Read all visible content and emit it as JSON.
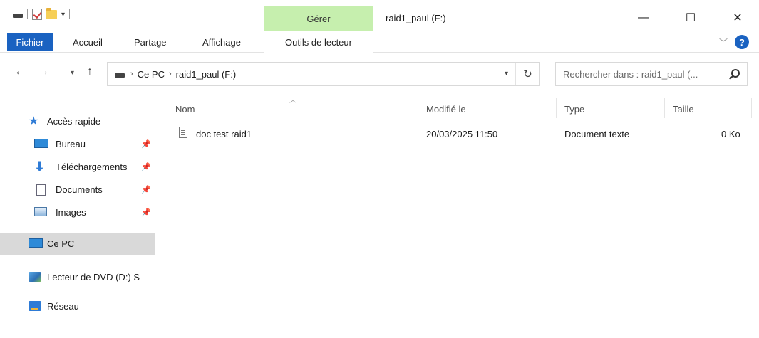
{
  "window": {
    "title": "raid1_paul (F:)",
    "manage_tab": "Gérer",
    "controls": {
      "minimize": "—",
      "maximize": "☐",
      "close": "✕"
    }
  },
  "ribbon": {
    "tabs": [
      "Fichier",
      "Accueil",
      "Partage",
      "Affichage",
      "Outils de lecteur"
    ],
    "collapse_icon": "chevron-down-icon",
    "help_label": "?"
  },
  "address": {
    "crumbs": [
      "Ce PC",
      "raid1_paul (F:)"
    ],
    "separator": "›"
  },
  "search": {
    "placeholder": "Rechercher dans : raid1_paul (..."
  },
  "nav_pane": {
    "items": [
      {
        "label": "Accès rapide",
        "icon": "star-icon",
        "pinned": false
      },
      {
        "label": "Bureau",
        "icon": "desktop-icon",
        "pinned": true
      },
      {
        "label": "Téléchargements",
        "icon": "download-icon",
        "pinned": true
      },
      {
        "label": "Documents",
        "icon": "documents-icon",
        "pinned": true
      },
      {
        "label": "Images",
        "icon": "pictures-icon",
        "pinned": true
      },
      {
        "label": "Ce PC",
        "icon": "computer-icon",
        "selected": true
      },
      {
        "label": "Lecteur de DVD (D:) S",
        "icon": "dvd-icon"
      },
      {
        "label": "Réseau",
        "icon": "network-icon"
      }
    ]
  },
  "file_list": {
    "columns": [
      "Nom",
      "Modifié le",
      "Type",
      "Taille"
    ],
    "rows": [
      {
        "name": "doc test raid1",
        "modified": "20/03/2025 11:50",
        "type": "Document texte",
        "size": "0 Ko"
      }
    ]
  },
  "colors": {
    "accent": "#1a62c1",
    "manage_green": "#c6efae",
    "selected": "#d9d9d9"
  }
}
